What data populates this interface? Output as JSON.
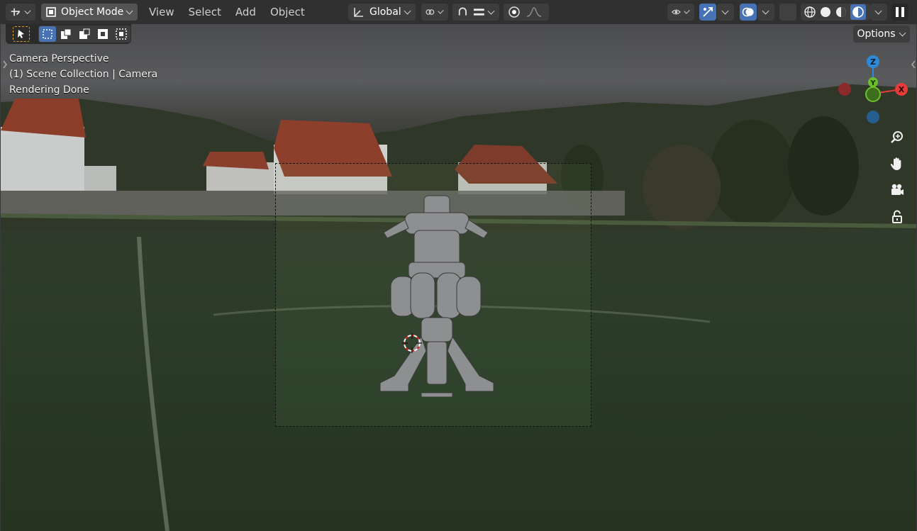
{
  "header": {
    "mode_label": "Object Mode",
    "menu": [
      "View",
      "Select",
      "Add",
      "Object"
    ],
    "transform_orientation": "Global"
  },
  "toolbar": {
    "options_label": "Options"
  },
  "viewport": {
    "overlay_lines": [
      "Camera Perspective",
      "(1) Scene Collection | Camera",
      "Rendering Done"
    ],
    "gizmo": {
      "z_label": "Z",
      "y_label": "Y",
      "x_label": "X"
    }
  },
  "colors": {
    "accent_blue": "#4772b3",
    "axis_x": "#e53b3b",
    "axis_y": "#6bbf2a",
    "axis_z": "#2d8ad9"
  },
  "icons": {
    "editor_type": "grid-view-icon",
    "zoom": "zoom-in-icon",
    "pan": "hand-icon",
    "camera_view": "camera-icon",
    "lock": "unlock-icon"
  }
}
